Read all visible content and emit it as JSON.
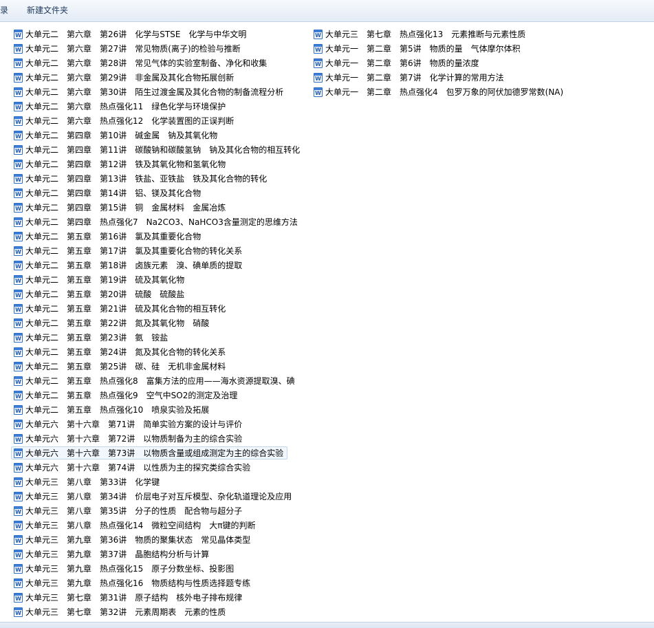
{
  "toolbar": {
    "partial_label": "录",
    "new_folder_label": "新建文件夹"
  },
  "file_icon": {
    "type": "word-document-icon",
    "glyph": "W",
    "color": "#2b6cc4"
  },
  "files": [
    {
      "name": "大单元二　第六章　第26讲　化学与STSE　化学与中华文明"
    },
    {
      "name": "大单元二　第六章　第27讲　常见物质(离子)的检验与推断"
    },
    {
      "name": "大单元二　第六章　第28讲　常见气体的实验室制备、净化和收集"
    },
    {
      "name": "大单元二　第六章　第29讲　非金属及其化合物拓展创新"
    },
    {
      "name": "大单元二　第六章　第30讲　陌生过渡金属及其化合物的制备流程分析"
    },
    {
      "name": "大单元二　第六章　热点强化11　绿色化学与环境保护"
    },
    {
      "name": "大单元二　第六章　热点强化12　化学装置图的正误判断"
    },
    {
      "name": "大单元二　第四章　第10讲　碱金属　钠及其氧化物"
    },
    {
      "name": "大单元二　第四章　第11讲　碳酸钠和碳酸氢钠　钠及其化合物的相互转化"
    },
    {
      "name": "大单元二　第四章　第12讲　铁及其氧化物和氢氧化物"
    },
    {
      "name": "大单元二　第四章　第13讲　铁盐、亚铁盐　铁及其化合物的转化"
    },
    {
      "name": "大单元二　第四章　第14讲　铝、镁及其化合物"
    },
    {
      "name": "大单元二　第四章　第15讲　铜　金属材料　金属冶炼"
    },
    {
      "name": "大单元二　第四章　热点强化7　Na2CO3、NaHCO3含量测定的思维方法"
    },
    {
      "name": "大单元二　第五章　第16讲　氯及其重要化合物"
    },
    {
      "name": "大单元二　第五章　第17讲　氯及其重要化合物的转化关系"
    },
    {
      "name": "大单元二　第五章　第18讲　卤族元素　溴、碘单质的提取"
    },
    {
      "name": "大单元二　第五章　第19讲　硫及其氧化物"
    },
    {
      "name": "大单元二　第五章　第20讲　硫酸　硫酸盐"
    },
    {
      "name": "大单元二　第五章　第21讲　硫及其化合物的相互转化"
    },
    {
      "name": "大单元二　第五章　第22讲　氮及其氧化物　硝酸"
    },
    {
      "name": "大单元二　第五章　第23讲　氨　铵盐"
    },
    {
      "name": "大单元二　第五章　第24讲　氮及其化合物的转化关系"
    },
    {
      "name": "大单元二　第五章　第25讲　碳、硅　无机非金属材料"
    },
    {
      "name": "大单元二　第五章　热点强化8　富集方法的应用——海水资源提取溴、碘"
    },
    {
      "name": "大单元二　第五章　热点强化9　空气中SO2的测定及治理"
    },
    {
      "name": "大单元二　第五章　热点强化10　喷泉实验及拓展"
    },
    {
      "name": "大单元六　第十六章　第71讲　简单实验方案的设计与评价"
    },
    {
      "name": "大单元六　第十六章　第72讲　以物质制备为主的综合实验"
    },
    {
      "name": "大单元六　第十六章　第73讲　以物质含量或组成测定为主的综合实验",
      "selected": true
    },
    {
      "name": "大单元六　第十六章　第74讲　以性质为主的探究类综合实验"
    },
    {
      "name": "大单元三　第八章　第33讲　化学键"
    },
    {
      "name": "大单元三　第八章　第34讲　价层电子对互斥模型、杂化轨道理论及应用"
    },
    {
      "name": "大单元三　第八章　第35讲　分子的性质　配合物与超分子"
    },
    {
      "name": "大单元三　第八章　热点强化14　微粒空间结构　大π键的判断"
    },
    {
      "name": "大单元三　第九章　第36讲　物质的聚集状态　常见晶体类型"
    },
    {
      "name": "大单元三　第九章　第37讲　晶胞结构分析与计算"
    },
    {
      "name": "大单元三　第九章　热点强化15　原子分数坐标、投影图"
    },
    {
      "name": "大单元三　第九章　热点强化16　物质结构与性质选择题专练"
    },
    {
      "name": "大单元三　第七章　第31讲　原子结构　核外电子排布规律"
    },
    {
      "name": "大单元三　第七章　第32讲　元素周期表　元素的性质"
    },
    {
      "name": "大单元三　第七章　热点强化13　元素推断与元素性质"
    },
    {
      "name": "大单元一　第二章　第5讲　物质的量　气体摩尔体积"
    },
    {
      "name": "大单元一　第二章　第6讲　物质的量浓度"
    },
    {
      "name": "大单元一　第二章　第7讲　化学计算的常用方法"
    },
    {
      "name": "大单元一　第二章　热点强化4　包罗万象的阿伏加德罗常数(NA)"
    }
  ]
}
